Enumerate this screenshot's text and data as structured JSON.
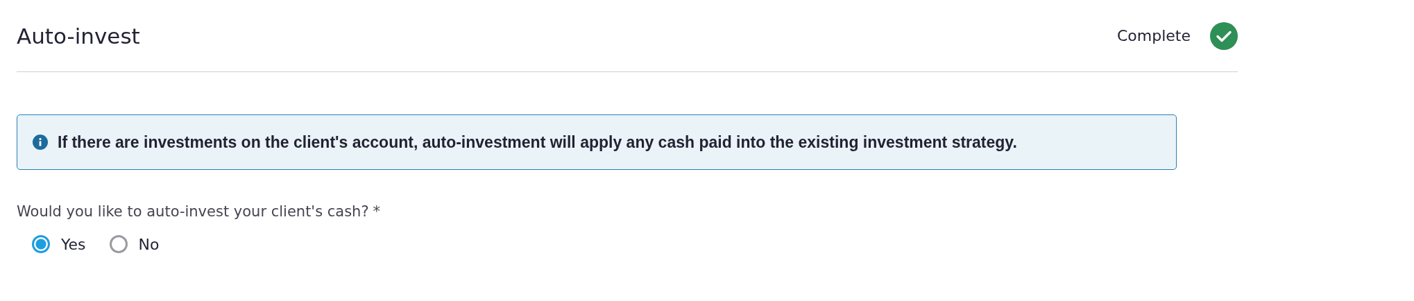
{
  "header": {
    "title": "Auto-invest",
    "status": {
      "label": "Complete",
      "complete": true
    }
  },
  "info": {
    "text": "If there are investments on the client's account, auto-investment will apply any cash paid into the existing investment strategy."
  },
  "question": {
    "label": "Would you like to auto-invest your client's cash?",
    "required_mark": "*",
    "options": [
      {
        "label": "Yes",
        "selected": true
      },
      {
        "label": "No",
        "selected": false
      }
    ]
  }
}
